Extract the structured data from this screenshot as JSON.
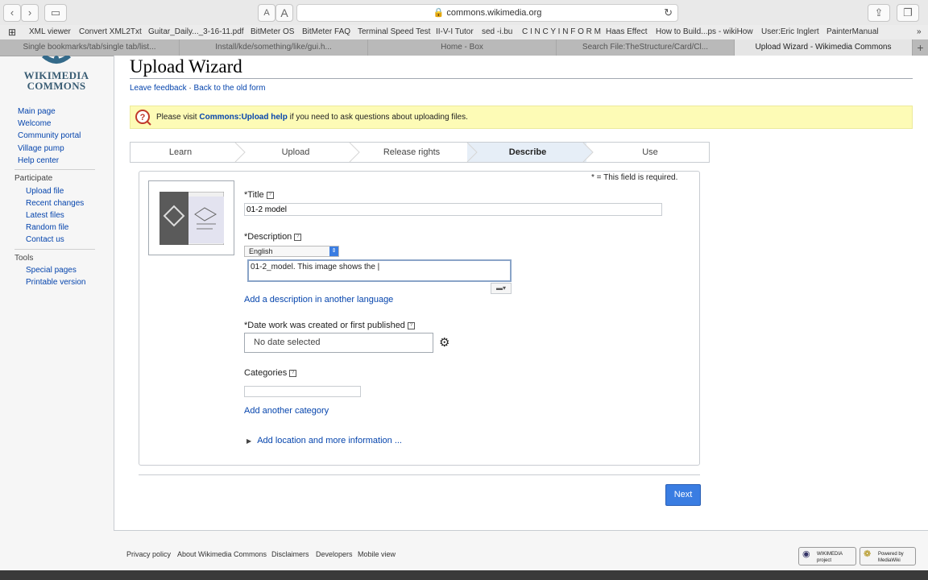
{
  "browser": {
    "url": "commons.wikimedia.org",
    "text_small": "A",
    "text_large": "A",
    "bookmarks": [
      "XML viewer",
      "Convert XML2Txt",
      "Guitar_Daily..._3-16-11.pdf",
      "BitMeter OS",
      "BitMeter FAQ",
      "Terminal Speed Test",
      "II-V-I Tutor",
      "sed -i.bu",
      "C I N C Y I N F O R M",
      "Haas Effect",
      "How to Build...ps - wikiHow",
      "User:Eric Inglert",
      "PainterManual"
    ],
    "tabs": [
      "Single bookmarks/tab/single tab/list...",
      "Install/kde/something/like/gui.h...",
      "Home - Box",
      "Search File:TheStructure/Card/Cl...",
      "Upload Wizard - Wikimedia Commons"
    ]
  },
  "logo": {
    "line1": "WIKIMEDIA",
    "line2": "COMMONS"
  },
  "sidebar": {
    "nav": [
      "Main page",
      "Welcome",
      "Community portal",
      "Village pump",
      "Help center"
    ],
    "participate_heading": "Participate",
    "participate": [
      "Upload file",
      "Recent changes",
      "Latest files",
      "Random file",
      "Contact us"
    ],
    "tools_heading": "Tools",
    "tools": [
      "Special pages",
      "Printable version"
    ]
  },
  "page": {
    "title": "Upload Wizard",
    "leave_feedback": "Leave feedback",
    "separator": "·",
    "back_link": "Back to the old form",
    "notice_pre": "Please visit ",
    "notice_link": "Commons:Upload help",
    "notice_post": " if you need to ask questions about uploading files."
  },
  "steps": [
    "Learn",
    "Upload",
    "Release rights",
    "Describe",
    "Use"
  ],
  "form": {
    "required_note": "* = This field is required.",
    "title_label": "*Title",
    "title_value": "01-2 model",
    "description_label": "*Description",
    "language": "English",
    "description_value": "01-2_model. This image shows the |",
    "add_description": "Add a description in another language",
    "date_label": "*Date work was created or first published",
    "date_value": "No date selected",
    "categories_label": "Categories",
    "add_category": "Add another category",
    "more_info": "Add location and more information ...",
    "next": "Next"
  },
  "footer": {
    "links": [
      "Privacy policy",
      "About Wikimedia Commons",
      "Disclaimers",
      "Developers",
      "Mobile view"
    ],
    "badge1": "WIKIMEDIA project",
    "badge2": "Powered by MediaWiki"
  },
  "colors": {
    "accent": "#3a7de2",
    "notice_bg": "#fdfbb6",
    "link": "#0645ad"
  }
}
